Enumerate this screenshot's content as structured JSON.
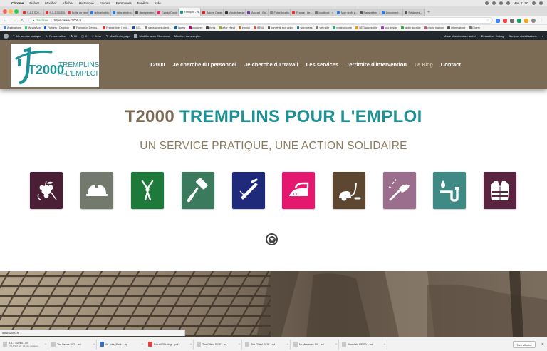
{
  "menubar": {
    "app": "Chrome",
    "items": [
      "Fichier",
      "Modifier",
      "Afficher",
      "Historique",
      "Favoris",
      "Personnes",
      "Fenêtre",
      "Aide"
    ],
    "clock": "Mar. 11:00"
  },
  "tabs": [
    {
      "label": "9-1-1 S02...",
      "color": "#d33"
    },
    {
      "label": "9-1-1 S02E0...",
      "color": "#d33"
    },
    {
      "label": "Boîte de récep...",
      "color": "#d44"
    },
    {
      "label": "rebs electric...",
      "color": "#2a7ae2"
    },
    {
      "label": "rebs electric...",
      "color": "#2a7ae2"
    },
    {
      "label": "decepteaten...",
      "color": "#555"
    },
    {
      "label": "Candy Crush...",
      "color": "#e26"
    },
    {
      "label": "Tremplin - N...",
      "color": "#1e9196",
      "active": true
    },
    {
      "label": "Adobe Creat...",
      "color": "#d22"
    },
    {
      "label": "Vos échange...",
      "color": "#333"
    },
    {
      "label": "Accueil | En...",
      "color": "#6a3fa0"
    },
    {
      "label": "Fiche locatio...",
      "color": "#888"
    },
    {
      "label": "France | Le...",
      "color": "#d33"
    },
    {
      "label": "localhost",
      "color": "#777"
    },
    {
      "label": "Mon profil p...",
      "color": "#2a7ae2"
    },
    {
      "label": "Paramètres",
      "color": "#555"
    },
    {
      "label": "Document...",
      "color": "#2a7ae2"
    },
    {
      "label": "Réglages...",
      "color": "#555"
    }
  ],
  "address": {
    "secure_label": "Sécurisé",
    "url": "https://www.t2000.fr"
  },
  "bookmarks": [
    "Applications",
    "WhatsApp",
    "Fichiers - Dropbox",
    "Formation Develo...",
    "France Inter / Info...",
    "LCL",
    "oasis accès client...",
    "jquery",
    "coutures",
    "fonts",
    "after effect",
    "emploi",
    "HTML",
    "convertir son vidéo",
    "wordpress",
    "web site",
    "vecteur icone",
    "SEO accessible",
    "tuto design",
    "jardin durable",
    "photo maman",
    "informatique",
    "Divers"
  ],
  "wpadmin": {
    "site": "Un service pratique",
    "customize": "Personnaliser",
    "comments": "0",
    "new": "Créer",
    "edit": "Modifier la page",
    "elementor": "Modifier avec Elementor",
    "mode": "Modèle : canvas.php",
    "maintenance": "Mode Maintenance activé",
    "debug": "Désactiver Debug",
    "greeting": "Bonjour, dtrealisations"
  },
  "logo": {
    "big": "T2000",
    "line1": "TREMPLINS",
    "line2_small": "POUR",
    "line2": "L'EMPLOI"
  },
  "nav": [
    "T2000",
    "Je cherche du personnel",
    "Je cherche du travail",
    "Les services",
    "Territoire d'intervention",
    "Le Blog",
    "Contact"
  ],
  "hero": {
    "title_part1": "T2000",
    "title_part2": "TREMPLINS POUR L'EMPLOI",
    "tagline": "UN SERVICE PRATIQUE, UNE ACTION SOLIDAIRE"
  },
  "services": [
    {
      "icon": "grapes-icon",
      "color": "#4a1e35"
    },
    {
      "icon": "hard-hat-icon",
      "color": "#74796d"
    },
    {
      "icon": "pruning-shears-icon",
      "color": "#1d7a3b"
    },
    {
      "icon": "paint-roller-icon",
      "color": "#3c7a5d"
    },
    {
      "icon": "trowel-icon",
      "color": "#1f2b7a"
    },
    {
      "icon": "iron-icon",
      "color": "#e4186f"
    },
    {
      "icon": "vacuum-cleaner-icon",
      "color": "#5e4731"
    },
    {
      "icon": "duster-icon",
      "color": "#9a6e8c"
    },
    {
      "icon": "plumbing-icon",
      "color": "#3f8a84"
    },
    {
      "icon": "safety-vest-icon",
      "color": "#5a2340"
    }
  ],
  "status_url": "www.t2000.fr",
  "downloads": [
    {
      "name": "9-1-1 S02E0...avi",
      "meta": "174,6/357 Mo, 19 min restantes",
      "type": "video"
    },
    {
      "name": "The.Deuce.S02....avi",
      "type": "video"
    },
    {
      "name": "All.Jobs_Pack....zip",
      "type": "zip"
    },
    {
      "name": "Bdc+%2F+dirigi....pdf",
      "type": "pdf"
    },
    {
      "name": "The.Gifted.S02E...avi",
      "type": "video"
    },
    {
      "name": "The.Gifted.S02E...avi",
      "type": "video"
    },
    {
      "name": "Mr.Mercedes.S0....avi",
      "type": "video"
    },
    {
      "name": "Riverdale.US.S0....avi",
      "type": "video"
    }
  ],
  "show_all": "Tout afficher"
}
